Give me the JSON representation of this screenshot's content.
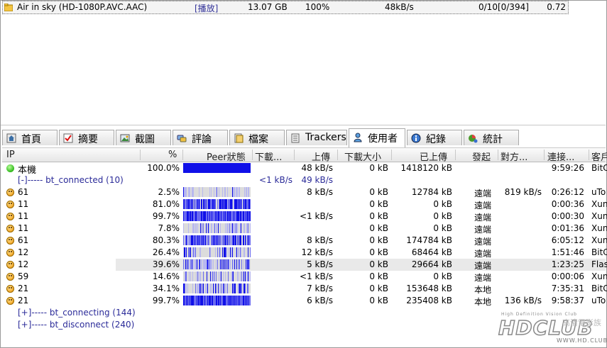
{
  "torrent": {
    "name": "Air in sky (HD-1080P.AVC.AAC)",
    "play": "[播放]",
    "size": "13.07 GB",
    "done": "100%",
    "upload_speed": "48kB/s",
    "peers": "0/10[0/394]",
    "ratio": "0.72"
  },
  "tabs": [
    {
      "label": "首頁",
      "icon": "home-icon"
    },
    {
      "label": "摘要",
      "icon": "checklist-icon"
    },
    {
      "label": "截圖",
      "icon": "image-icon"
    },
    {
      "label": "評論",
      "icon": "comments-icon"
    },
    {
      "label": "檔案",
      "icon": "files-icon"
    },
    {
      "label": "Trackers",
      "icon": "tracker-icon"
    },
    {
      "label": "使用者",
      "icon": "users-icon"
    },
    {
      "label": "紀錄",
      "icon": "info-icon"
    },
    {
      "label": "統計",
      "icon": "stats-icon"
    }
  ],
  "active_tab": "使用者",
  "columns": {
    "ip": "IP",
    "pct": "%",
    "peer_status": "Peer狀態",
    "download": "下載...",
    "upload": "上傳",
    "dl_size": "下載大小",
    "uploaded": "已上傳",
    "initiator": "發起",
    "remote_speed": "對方...",
    "connected": "連接...",
    "client": "客戶"
  },
  "local": {
    "ip": "本機",
    "pct": "100.0%",
    "pct_value": 100,
    "upload": "48 kB/s",
    "dl_size": "0 kB",
    "uploaded": "1418120 kB",
    "connected": "9:59:26",
    "client": "BitC"
  },
  "groups": {
    "connected": {
      "label": "[-]----- bt_connected (10)",
      "download": "<1 kB/s",
      "upload": "49 kB/s"
    },
    "connecting": {
      "label": "[+]----- bt_connecting (144)"
    },
    "disconnect": {
      "label": "[+]----- bt_disconnect (240)"
    }
  },
  "peers": [
    {
      "ip": "61",
      "pct": "2.5%",
      "pct_value": 2.5,
      "upload": "8 kB/s",
      "dl_size": "0 kB",
      "uploaded": "12784 kB",
      "initiator": "遠端",
      "remote_speed": "819 kB/s",
      "connected": "0:26:12",
      "client": "uTo"
    },
    {
      "ip": "11",
      "pct": "81.0%",
      "pct_value": 81.0,
      "upload": "",
      "dl_size": "0 kB",
      "uploaded": "0 kB",
      "initiator": "遠端",
      "remote_speed": "",
      "connected": "0:00:36",
      "client": "Xun"
    },
    {
      "ip": "11",
      "pct": "99.7%",
      "pct_value": 99.7,
      "upload": "<1 kB/s",
      "dl_size": "0 kB",
      "uploaded": "0 kB",
      "initiator": "遠端",
      "remote_speed": "",
      "connected": "0:00:30",
      "client": "Xun"
    },
    {
      "ip": "11",
      "pct": "7.8%",
      "pct_value": 7.8,
      "upload": "",
      "dl_size": "0 kB",
      "uploaded": "0 kB",
      "initiator": "遠端",
      "remote_speed": "",
      "connected": "0:01:36",
      "client": "Xun"
    },
    {
      "ip": "61",
      "pct": "80.3%",
      "pct_value": 80.3,
      "upload": "8 kB/s",
      "dl_size": "0 kB",
      "uploaded": "174784 kB",
      "initiator": "遠端",
      "remote_speed": "",
      "connected": "6:05:12",
      "client": "Xun"
    },
    {
      "ip": "12",
      "pct": "26.4%",
      "pct_value": 26.4,
      "upload": "12 kB/s",
      "dl_size": "0 kB",
      "uploaded": "68464 kB",
      "initiator": "遠端",
      "remote_speed": "",
      "connected": "1:51:46",
      "client": "BitC"
    },
    {
      "ip": "12",
      "pct": "39.6%",
      "pct_value": 39.6,
      "upload": "5 kB/s",
      "dl_size": "0 kB",
      "uploaded": "29664 kB",
      "initiator": "遠端",
      "remote_speed": "",
      "connected": "1:23:25",
      "client": "Flas",
      "highlight": true
    },
    {
      "ip": "59",
      "pct": "14.6%",
      "pct_value": 14.6,
      "upload": "<1 kB/s",
      "dl_size": "0 kB",
      "uploaded": "0 kB",
      "initiator": "遠端",
      "remote_speed": "",
      "connected": "0:00:06",
      "client": "Xun"
    },
    {
      "ip": "21",
      "pct": "34.1%",
      "pct_value": 34.1,
      "upload": "7 kB/s",
      "dl_size": "0 kB",
      "uploaded": "153648 kB",
      "initiator": "本地",
      "remote_speed": "",
      "connected": "7:35:31",
      "client": "BitC"
    },
    {
      "ip": "21",
      "pct": "99.7%",
      "pct_value": 99.7,
      "upload": "6 kB/s",
      "dl_size": "0 kB",
      "uploaded": "235408 kB",
      "initiator": "本地",
      "remote_speed": "136 kB/s",
      "connected": "9:58:37",
      "client": "uTo"
    }
  ],
  "logo": {
    "tagline": "High Definition Vision Club",
    "brand": "HDCLUB",
    "chinese": "高清電影族",
    "url": "WWW.HD.CLUB.TW"
  },
  "colors": {
    "bar_fill": "#1010e8",
    "bar_partial": "#6a6af0",
    "bar_empty": "#dcdcdc",
    "group_text": "#2b2b99"
  }
}
